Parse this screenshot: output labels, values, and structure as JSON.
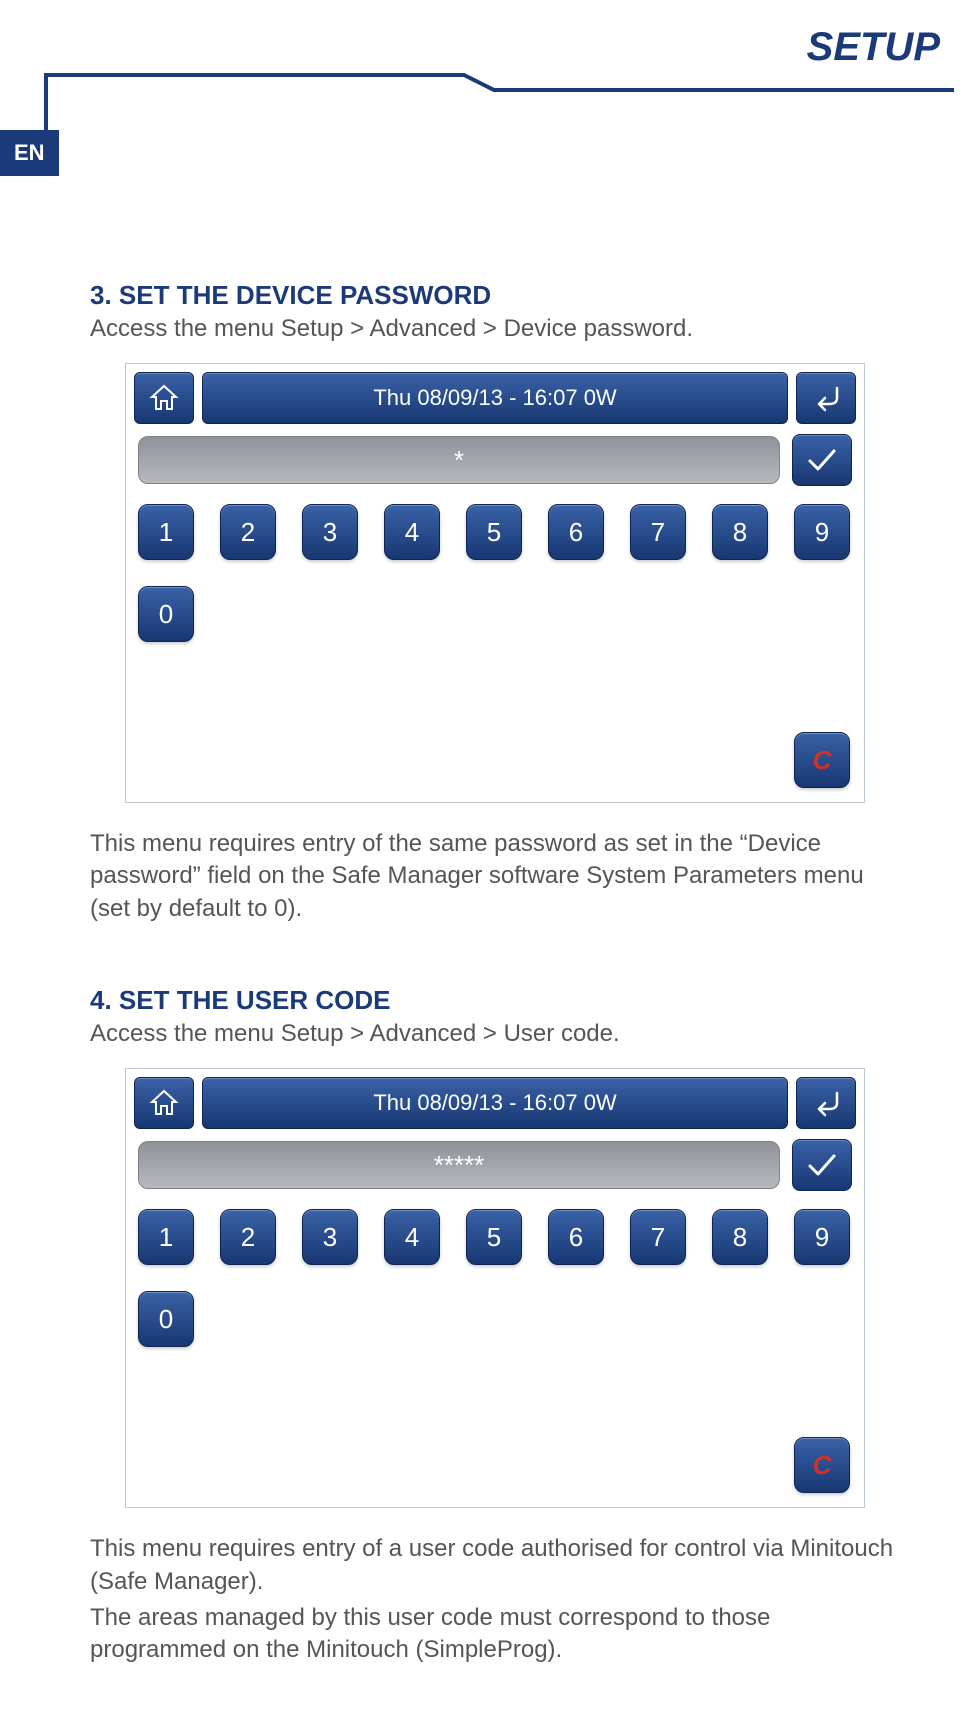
{
  "header": {
    "title": "SETUP"
  },
  "lang_badge": "EN",
  "section3": {
    "heading": "3. SET THE DEVICE PASSWORD",
    "subtitle": "Access the menu Setup > Advanced > Device password.",
    "panel": {
      "titlebar": "Thu 08/09/13 - 16:07  0W",
      "input_value": "*",
      "keys": [
        "1",
        "2",
        "3",
        "4",
        "5",
        "6",
        "7",
        "8",
        "9",
        "0"
      ],
      "clear_label": "C"
    },
    "description": "This menu requires entry of the same password as set in the “Device password” field on the Safe Manager software System Parameters menu (set by default to 0)."
  },
  "section4": {
    "heading": "4. SET THE USER CODE",
    "subtitle": "Access the menu Setup > Advanced > User code.",
    "panel": {
      "titlebar": "Thu 08/09/13 - 16:07  0W",
      "input_value": "*****",
      "keys": [
        "1",
        "2",
        "3",
        "4",
        "5",
        "6",
        "7",
        "8",
        "9",
        "0"
      ],
      "clear_label": "C"
    },
    "description1": "This menu requires entry of a user code authorised for control via Minitouch (Safe Manager).",
    "description2": "The areas managed by this user code must correspond to those programmed on the Minitouch (SimpleProg)."
  }
}
